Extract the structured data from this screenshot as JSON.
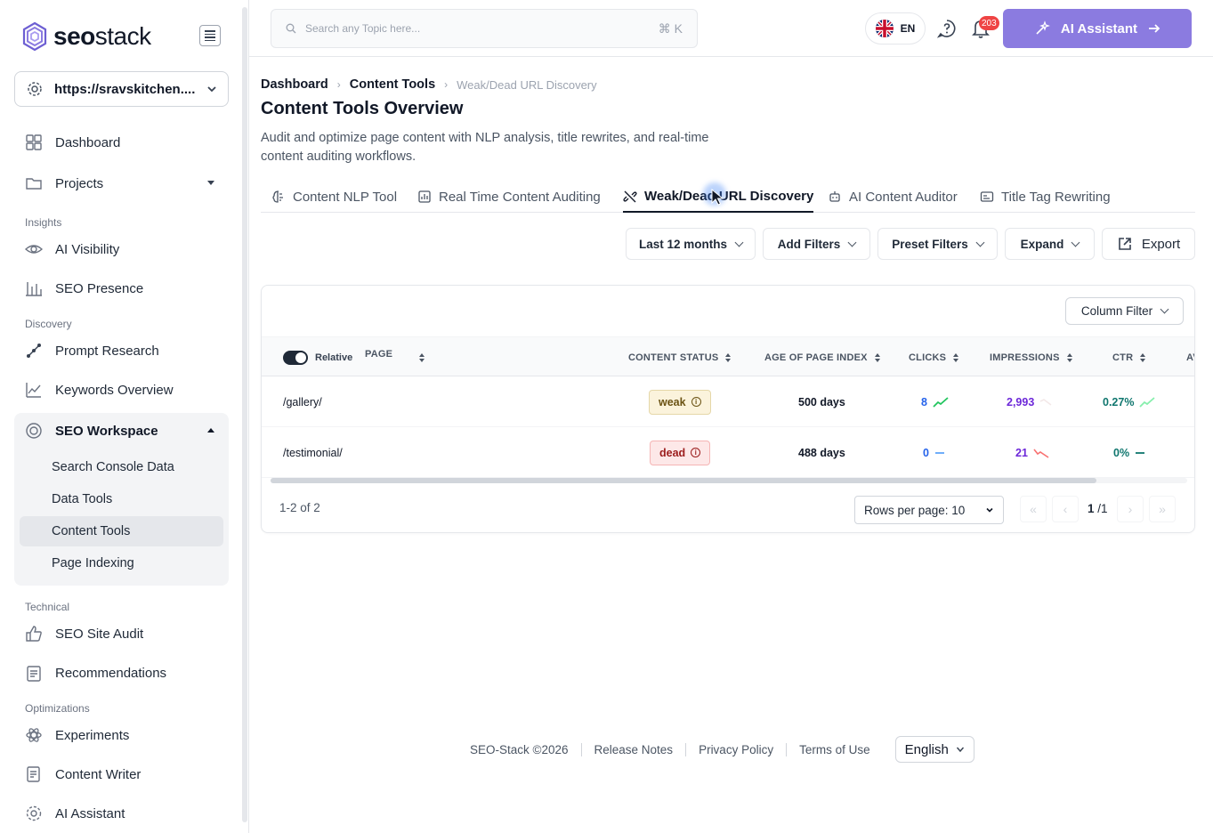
{
  "brand": {
    "name_bold": "seo",
    "name_light": "stack"
  },
  "site_selector": {
    "value": "https://sravskitchen...."
  },
  "sidebar": {
    "items": [
      {
        "label": "Dashboard"
      },
      {
        "label": "Projects"
      }
    ],
    "sections": {
      "insights": "Insights",
      "discovery": "Discovery",
      "technical": "Technical",
      "optimizations": "Optimizations"
    },
    "insights_items": [
      {
        "label": "AI Visibility"
      },
      {
        "label": "SEO Presence"
      }
    ],
    "discovery_items": [
      {
        "label": "Prompt Research"
      },
      {
        "label": "Keywords Overview"
      }
    ],
    "workspace": {
      "label": "SEO Workspace",
      "sub": [
        {
          "label": "Search Console Data"
        },
        {
          "label": "Data Tools"
        },
        {
          "label": "Content Tools"
        },
        {
          "label": "Page Indexing"
        }
      ]
    },
    "technical_items": [
      {
        "label": "SEO Site Audit"
      },
      {
        "label": "Recommendations"
      }
    ],
    "optimization_items": [
      {
        "label": "Experiments"
      },
      {
        "label": "Content Writer"
      },
      {
        "label": "AI Assistant"
      }
    ]
  },
  "header": {
    "search_placeholder": "Search any Topic here...",
    "shortcut": "⌘ K",
    "language": "EN",
    "notification_count": "203",
    "ai_button": "AI Assistant"
  },
  "breadcrumb": {
    "root": "Dashboard",
    "parent": "Content Tools",
    "current": "Weak/Dead URL Discovery"
  },
  "page": {
    "title": "Content Tools Overview",
    "description": "Audit and optimize page content with NLP analysis, title rewrites, and real-time content auditing workflows."
  },
  "tabs": [
    {
      "label": "Content NLP Tool"
    },
    {
      "label": "Real Time Content Auditing"
    },
    {
      "label": "Weak/Dead URL Discovery"
    },
    {
      "label": "AI Content Auditor"
    },
    {
      "label": "Title Tag Rewriting"
    }
  ],
  "filters": {
    "date_range": "Last 12 months",
    "add_filters": "Add Filters",
    "preset_filters": "Preset Filters",
    "expand": "Expand",
    "export": "Export"
  },
  "table": {
    "column_filter": "Column Filter",
    "relative_label": "Relative",
    "relative_on": true,
    "columns": {
      "page": "PAGE",
      "content_status": "CONTENT STATUS",
      "age": "AGE OF PAGE INDEX",
      "clicks": "CLICKS",
      "impressions": "IMPRESSIONS",
      "ctr": "CTR",
      "avg": "AV"
    },
    "rows": [
      {
        "page": "/gallery/",
        "status": "weak",
        "age": "500 days",
        "clicks": "8",
        "impressions": "2,993",
        "ctr": "0.27%"
      },
      {
        "page": "/testimonial/",
        "status": "dead",
        "age": "488 days",
        "clicks": "0",
        "impressions": "21",
        "ctr": "0%"
      }
    ],
    "count_text": "1-2 of 2",
    "rows_per_page": "Rows per page: 10",
    "current_page": "1",
    "total_pages": "/1"
  },
  "footer": {
    "copyright": "SEO-Stack ©2026",
    "release_notes": "Release Notes",
    "privacy": "Privacy Policy",
    "terms": "Terms of Use",
    "language": "English"
  },
  "colors": {
    "accent": "#8b7be0",
    "clicks_blue": "#2563eb",
    "impressions_purple": "#6d28d9",
    "ctr_teal": "#0f766e",
    "trend_up": "#22c55e",
    "trend_down": "#f87171"
  }
}
